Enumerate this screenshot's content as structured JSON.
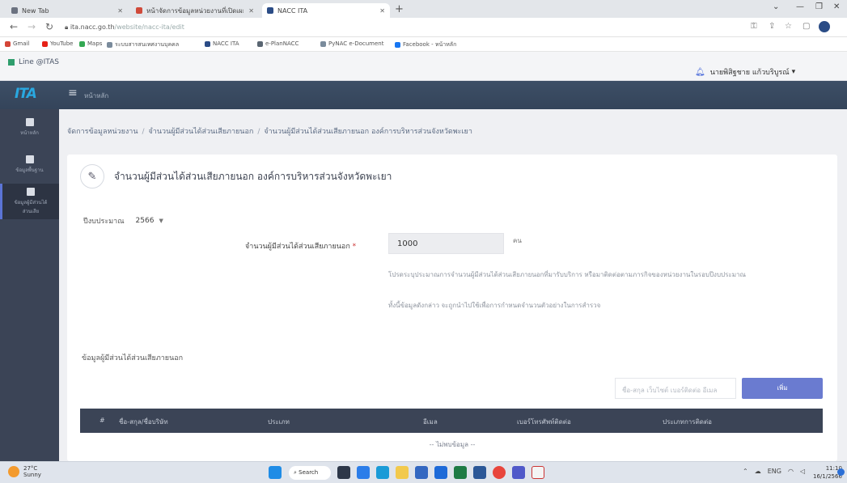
{
  "browser": {
    "tabs": [
      {
        "label": "New Tab",
        "color": "#6b7280"
      },
      {
        "label": "หน้าจัดการข้อมูลหน่วยงานที่เปิดเผย",
        "color": "#d04a3a"
      },
      {
        "label": "NACC ITA",
        "color": "#2b4c86"
      }
    ],
    "url_host": "ita.nacc.go.th",
    "url_path": "/website/nacc-ita/edit",
    "bookmarks": [
      "Gmail",
      "YouTube",
      "Maps",
      "ระบบสารสนเทศงานบุคคล",
      "NACC ITA",
      "e-PlanNACC",
      "PyNAC e-Document",
      "Facebook - หน้าหลัก"
    ]
  },
  "site": {
    "name": "Line @ITAS",
    "user_name": "นายพิสิฐชาย แก้วบริบูรณ์"
  },
  "app": {
    "logo": "ITA",
    "name": "หน้าหลัก"
  },
  "sidebar": {
    "items": [
      {
        "label": "หน้าหลัก",
        "label2": ""
      },
      {
        "label": "ข้อมูลพื้นฐาน",
        "label2": ""
      },
      {
        "label": "ข้อมูลผู้มีส่วนได้",
        "label2": "ส่วนเสีย"
      }
    ]
  },
  "breadcrumb": {
    "item1": "จัดการข้อมูลหน่วยงาน",
    "item2": "จำนวนผู้มีส่วนได้ส่วนเสียภายนอก",
    "item3": "จำนวนผู้มีส่วนได้ส่วนเสียภายนอก องค์การบริหารส่วนจังหวัดพะเยา"
  },
  "page": {
    "title": "จำนวนผู้มีส่วนได้ส่วนเสียภายนอก องค์การบริหารส่วนจังหวัดพะเยา",
    "year_label": "ปีงบประมาณ",
    "year_value": "2566",
    "field_label": "จำนวนผู้มีส่วนได้ส่วนเสียภายนอก",
    "field_required": "*",
    "field_value": "1000",
    "field_unit": "คน",
    "help1": "โปรดระบุประมาณการจำนวนผู้มีส่วนได้ส่วนเสียภายนอกที่มารับบริการ หรือมาติดต่อตามภารกิจของหน่วยงานในรอบปีงบประมาณ",
    "help2": "ทั้งนี้ข้อมูลดังกล่าว จะถูกนำไปใช้เพื่อการกำหนดจำนวนตัวอย่างในการสำรวจ",
    "section_title": "ข้อมูลผู้มีส่วนได้ส่วนเสียภายนอก",
    "search_placeholder": "ชื่อ-สกุล เว็บไซต์ เบอร์ติดต่อ อีเมล",
    "add_button": "เพิ่ม",
    "table_headers": [
      "#",
      "ชื่อ-สกุล/ชื่อบริษัท",
      "ประเภท",
      "อีเมล",
      "เบอร์โทรศัพท์ติดต่อ",
      "ประเภทการติดต่อ"
    ],
    "no_data": "-- ไม่พบข้อมูล --"
  },
  "taskbar": {
    "weather_temp": "27°C",
    "weather_desc": "Sunny",
    "search_label": "Search",
    "tray_lang": "ENG",
    "time": "11:10",
    "date": "16/1/2566"
  }
}
